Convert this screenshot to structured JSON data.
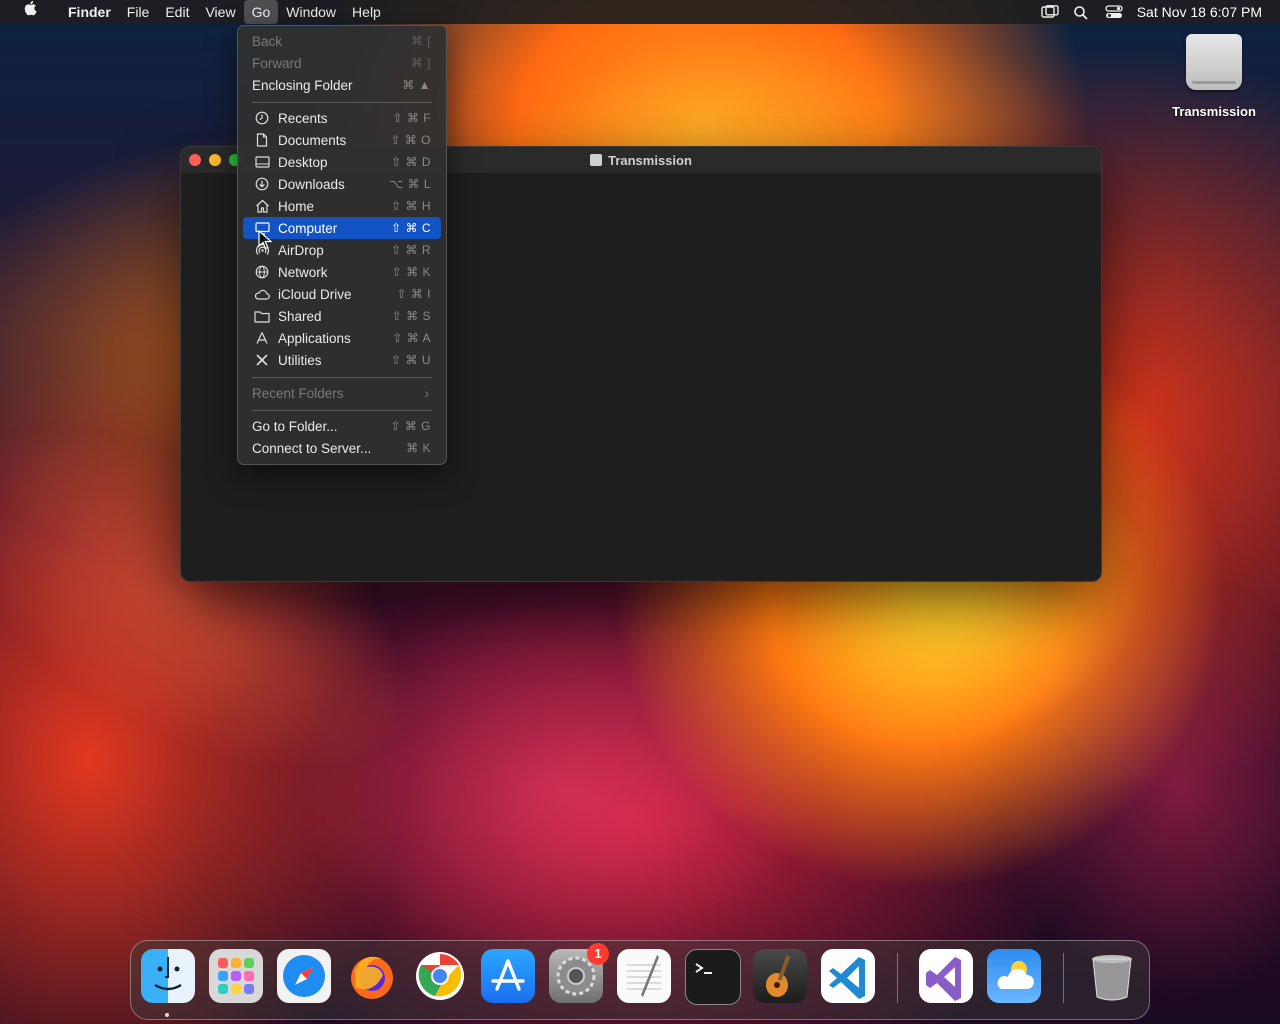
{
  "menubar": {
    "app_name": "Finder",
    "items": [
      "File",
      "Edit",
      "View",
      "Go",
      "Window",
      "Help"
    ],
    "clock": "Sat Nov 18  6:07 PM"
  },
  "desktop": {
    "drive_label": "Transmission"
  },
  "finder_window": {
    "title": "Transmission"
  },
  "go_menu": {
    "items": [
      {
        "label": "Back",
        "shortcut": "⌘ [",
        "disabled": true
      },
      {
        "label": "Forward",
        "shortcut": "⌘ ]",
        "disabled": true
      },
      {
        "label": "Enclosing Folder",
        "shortcut": "⌘ ▲"
      },
      {
        "label": "Recents",
        "shortcut": "⇧ ⌘ F",
        "icon": "clock-icon"
      },
      {
        "label": "Documents",
        "shortcut": "⇧ ⌘ O",
        "icon": "document-icon"
      },
      {
        "label": "Desktop",
        "shortcut": "⇧ ⌘ D",
        "icon": "desktop-icon"
      },
      {
        "label": "Downloads",
        "shortcut": "⌥ ⌘ L",
        "icon": "download-icon"
      },
      {
        "label": "Home",
        "shortcut": "⇧ ⌘ H",
        "icon": "home-icon"
      },
      {
        "label": "Computer",
        "shortcut": "⇧ ⌘ C",
        "icon": "computer-icon",
        "selected": true
      },
      {
        "label": "AirDrop",
        "shortcut": "⇧ ⌘ R",
        "icon": "airdrop-icon"
      },
      {
        "label": "Network",
        "shortcut": "⇧ ⌘ K",
        "icon": "globe-icon"
      },
      {
        "label": "iCloud Drive",
        "shortcut": "⇧ ⌘ I",
        "icon": "cloud-icon"
      },
      {
        "label": "Shared",
        "shortcut": "⇧ ⌘ S",
        "icon": "shared-folder-icon"
      },
      {
        "label": "Applications",
        "shortcut": "⇧ ⌘ A",
        "icon": "applications-icon"
      },
      {
        "label": "Utilities",
        "shortcut": "⇧ ⌘ U",
        "icon": "utilities-icon"
      },
      {
        "label": "Recent Folders",
        "disabled": true,
        "submenu": true
      },
      {
        "label": "Go to Folder...",
        "shortcut": "⇧ ⌘ G"
      },
      {
        "label": "Connect to Server...",
        "shortcut": "⌘ K"
      }
    ]
  },
  "dock": {
    "apps": [
      "finder-icon",
      "launchpad-icon",
      "safari-icon",
      "firefox-icon",
      "chrome-icon",
      "app-store-icon",
      "system-settings-icon",
      "textedit-icon",
      "terminal-icon",
      "garageband-icon",
      "vscode-icon",
      "visual-studio-icon",
      "weather-icon",
      "trash-icon"
    ],
    "settings_badge": "1"
  },
  "colors": {
    "menu_selection": "#1354c4",
    "close": "#ff5f57",
    "minimize": "#febc2e",
    "zoom": "#28c840"
  }
}
